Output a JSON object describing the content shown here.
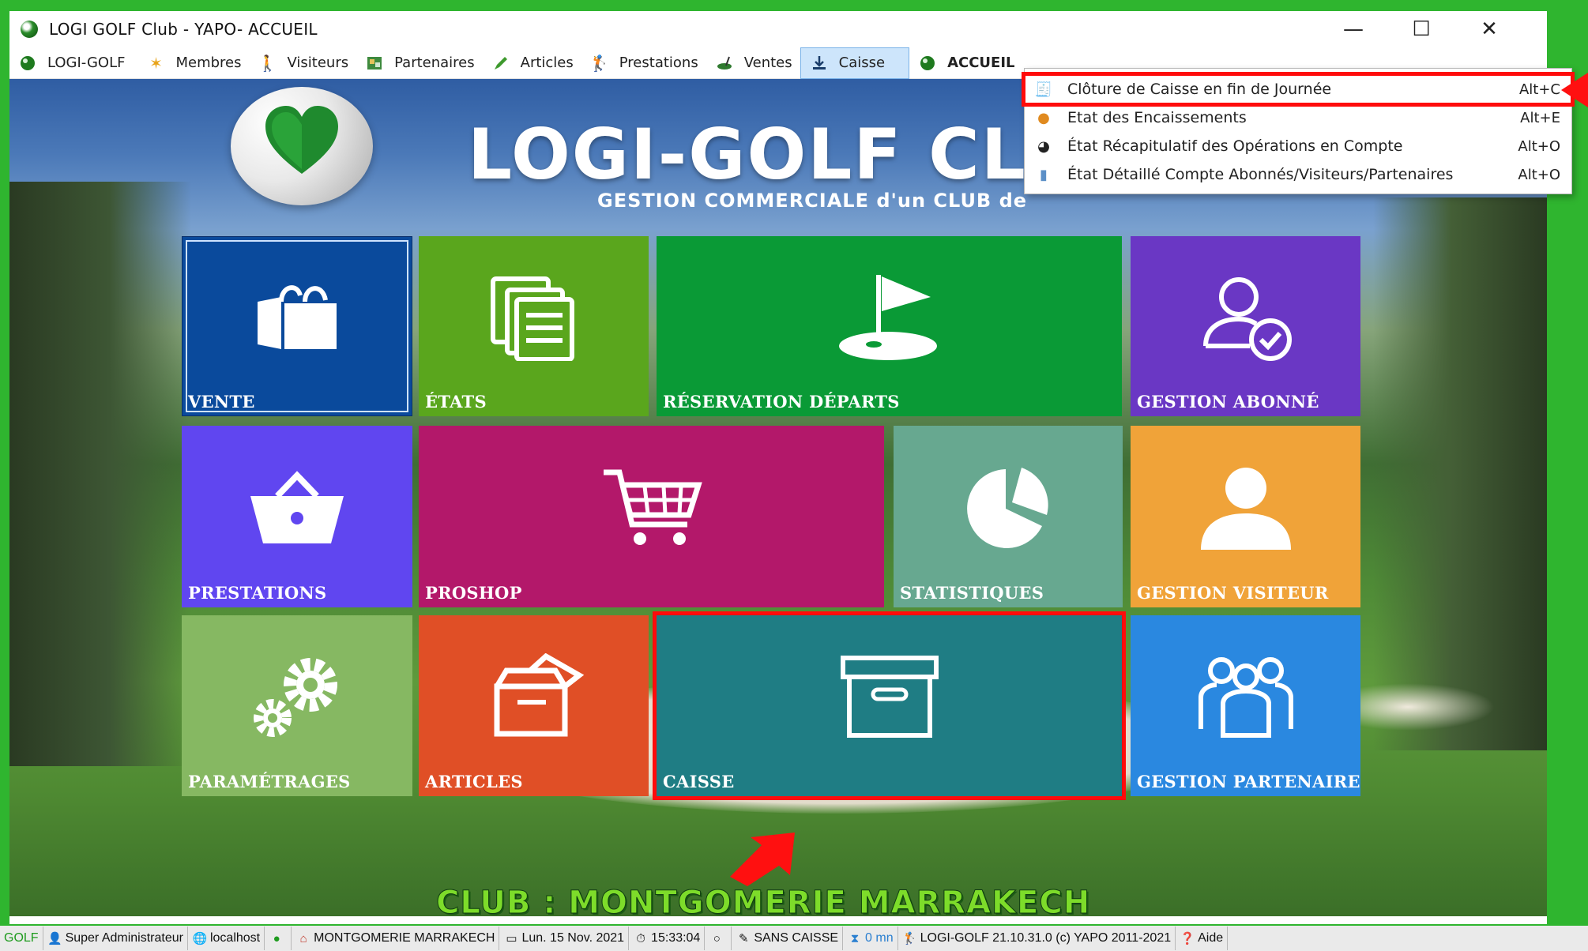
{
  "window": {
    "title": "LOGI GOLF Club - YAPO- ACCUEIL",
    "minimize": "—",
    "maximize": "☐",
    "close": "✕"
  },
  "menu": {
    "items": [
      {
        "label": "LOGI-GOLF",
        "icon": "golf-ball-icon"
      },
      {
        "label": "Membres",
        "icon": "member-icon"
      },
      {
        "label": "Visiteurs",
        "icon": "walker-icon"
      },
      {
        "label": "Partenaires",
        "icon": "partner-icon"
      },
      {
        "label": "Articles",
        "icon": "pencil-icon"
      },
      {
        "label": "Prestations",
        "icon": "golfer-icon"
      },
      {
        "label": "Ventes",
        "icon": "sale-icon"
      },
      {
        "label": "Caisse",
        "icon": "download-icon"
      },
      {
        "label": "ACCUEIL",
        "icon": "home-ball-icon"
      }
    ]
  },
  "dropdown": {
    "items": [
      {
        "label": "Clôture de Caisse en fin de Journée",
        "shortcut": "Alt+C"
      },
      {
        "label": "Etat des Encaissements",
        "shortcut": "Alt+E"
      },
      {
        "label": "État Récapitulatif des Opérations en Compte",
        "shortcut": "Alt+O"
      },
      {
        "label": "État Détaillé Compte Abonnés/Visiteurs/Partenaires",
        "shortcut": "Alt+O"
      }
    ]
  },
  "header": {
    "title": "LOGI-GOLF CLU",
    "subtitle": "GESTION COMMERCIALE d'un CLUB de"
  },
  "tiles": {
    "vente": "VENTE",
    "etats": "ÉTATS",
    "reservation": "RÉSERVATION DÉPARTS",
    "abonne": "GESTION ABONNÉ",
    "prestations": "PRESTATIONS",
    "proshop": "PROSHOP",
    "statistiques": "STATISTIQUES",
    "visiteur": "GESTION VISITEUR",
    "parametrages": "PARAMÉTRAGES",
    "articles": "ARTICLES",
    "caisse": "CAISSE",
    "partenaire": "GESTION PARTENAIRE"
  },
  "colors": {
    "vente": "#0a4a9c",
    "etats": "#5aa61d",
    "reservation": "#0a9a36",
    "abonne": "#6a37c4",
    "prestations": "#6046f0",
    "proshop": "#b3186a",
    "statistiques": "#67a890",
    "visiteur": "#f0a339",
    "parametrages": "#86b862",
    "articles": "#e04f26",
    "caisse": "#1f7d84",
    "partenaire": "#2a88e0",
    "highlight": "#ff0b0b"
  },
  "club": {
    "name": "CLUB : MONTGOMERIE MARRAKECH"
  },
  "status": {
    "golf": "GOLF",
    "user": "Super Administrateur",
    "host": "localhost",
    "club": "MONTGOMERIE MARRAKECH",
    "date": "Lun. 15 Nov. 2021",
    "time": "15:33:04",
    "caisse": "SANS CAISSE",
    "duration": "0 mn",
    "version": "LOGI-GOLF 21.10.31.0  (c) YAPO 2011-2021",
    "help": "Aide"
  }
}
